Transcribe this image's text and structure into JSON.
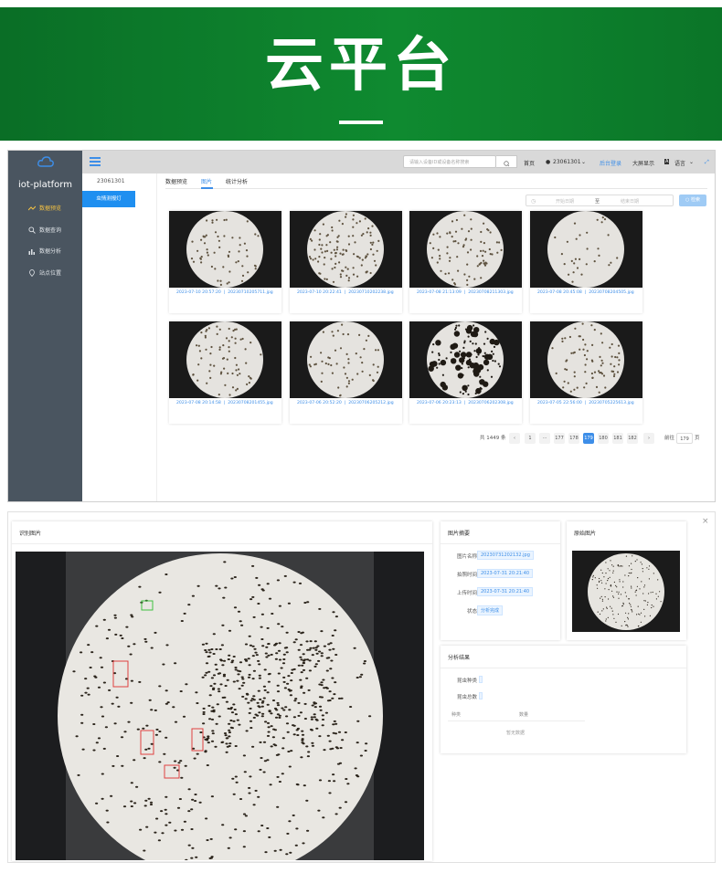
{
  "banner": {
    "title": "云平台"
  },
  "app": {
    "brand": "iot-platform",
    "menu": [
      {
        "label": "数据预览",
        "icon": "trend-icon",
        "active": true
      },
      {
        "label": "数据查询",
        "icon": "search-icon",
        "active": false
      },
      {
        "label": "数据分析",
        "icon": "bar-chart-icon",
        "active": false
      },
      {
        "label": "站点位置",
        "icon": "location-icon",
        "active": false
      }
    ],
    "topbar": {
      "search_placeholder": "请输入设备ID或设备名称搜索",
      "home": "首页",
      "user": "23061301",
      "backend": "后台登录",
      "bigscreen": "大屏显示",
      "language": "语言"
    },
    "tree": {
      "device_id": "23061301",
      "device_button": "虫情测报灯"
    },
    "tabs": [
      "数据预览",
      "图片",
      "统计分析"
    ],
    "active_tab": "图片",
    "filter": {
      "start_placeholder": "开始日期",
      "separator": "至",
      "end_placeholder": "结束日期",
      "query": "检索"
    },
    "images": [
      {
        "time": "2023-07-10 20:57:20",
        "file": "20230710205711.jpg"
      },
      {
        "time": "2023-07-10 20:22:41",
        "file": "20230710202238.jpg"
      },
      {
        "time": "2023-07-08 21:13:09",
        "file": "20230708211303.jpg"
      },
      {
        "time": "2023-07-08 20:45:08",
        "file": "20230708204505.jpg"
      },
      {
        "time": "2023-07-08 20:14:58",
        "file": "20230708201455.jpg"
      },
      {
        "time": "2023-07-06 20:52:20",
        "file": "20230706205212.jpg"
      },
      {
        "time": "2023-07-06 20:23:13",
        "file": "20230706202308.jpg"
      },
      {
        "time": "2023-07-05 22:56:00",
        "file": "20230705225613.jpg"
      }
    ],
    "pagination": {
      "total": "共 1449 条",
      "pages": [
        "1",
        "···",
        "177",
        "178",
        "179",
        "180",
        "181",
        "182"
      ],
      "active_page": "179",
      "goto_label": "前往",
      "goto_value": "179",
      "page_suffix": "页"
    }
  },
  "detail": {
    "recognized_title": "识别图片",
    "summary_title": "图片摘要",
    "original_title": "原始图片",
    "result_title": "分析结果",
    "fields": [
      {
        "label": "图片名称",
        "value": "20230731202132.jpg"
      },
      {
        "label": "拍照时间",
        "value": "2023-07-31 20:21:40"
      },
      {
        "label": "上传时间",
        "value": "2023-07-31 20:21:40"
      },
      {
        "label": "状态",
        "value": "分析完成"
      }
    ],
    "result": {
      "species_label": "昆虫种类",
      "total_label": "昆虫总数",
      "col_type": "种类",
      "col_count": "数量",
      "empty": "暂无数据"
    },
    "close": "×"
  },
  "colors": {
    "accent": "#3d8ee8",
    "banner": "#0f8a30",
    "sidebar": "#4a5560",
    "highlight": "#f5c242"
  }
}
